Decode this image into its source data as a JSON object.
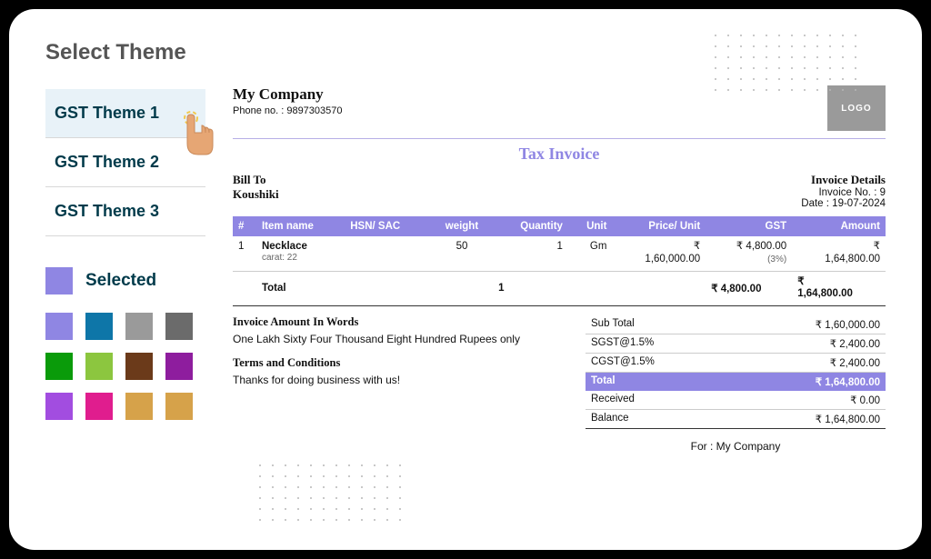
{
  "sidebar": {
    "title": "Select Theme",
    "themes": [
      "GST Theme 1",
      "GST Theme 2",
      "GST Theme 3"
    ],
    "selected_index": 0,
    "selected_label": "Selected",
    "palette_colors": [
      "#8f86e3",
      "#0e76a8",
      "#9a9a9a",
      "#6b6b6b",
      "#0a9b0a",
      "#8cc63f",
      "#6b3a1a",
      "#8e1d9e",
      "#a24de0",
      "#e01d8e",
      "#d6a24a",
      "#d6a24a"
    ]
  },
  "invoice": {
    "company_name": "My Company",
    "phone_label": "Phone no. : ",
    "phone": "9897303570",
    "logo_text": "LOGO",
    "doc_title": "Tax Invoice",
    "bill_to_label": "Bill To",
    "bill_to_name": "Koushiki",
    "details_label": "Invoice Details",
    "invoice_no_label": "Invoice No. : ",
    "invoice_no": "9",
    "date_label": "Date : ",
    "date": "19-07-2024",
    "columns": [
      "#",
      "Item name",
      "HSN/ SAC",
      "weight",
      "Quantity",
      "Unit",
      "Price/ Unit",
      "GST",
      "Amount"
    ],
    "row": {
      "idx": "1",
      "name": "Necklace",
      "subline": "carat: 22",
      "hsn": "",
      "weight": "50",
      "qty": "1",
      "unit": "Gm",
      "price_top": "₹",
      "price": "1,60,000.00",
      "gst_top": "₹ 4,800.00",
      "gst_sub": "(3%)",
      "amount_top": "₹",
      "amount": "1,64,800.00"
    },
    "totals_row": {
      "label": "Total",
      "qty": "1",
      "gst": "₹ 4,800.00",
      "amount_top": "₹",
      "amount": "1,64,800.00"
    },
    "words_label": "Invoice Amount In Words",
    "words": "One Lakh Sixty Four Thousand Eight Hundred Rupees only",
    "terms_label": "Terms and Conditions",
    "terms": "Thanks for doing business with us!",
    "summary": [
      {
        "label": "Sub Total",
        "value": "₹ 1,60,000.00"
      },
      {
        "label": "SGST@1.5%",
        "value": "₹ 2,400.00"
      },
      {
        "label": "CGST@1.5%",
        "value": "₹ 2,400.00"
      }
    ],
    "grand_total": {
      "label": "Total",
      "value": "₹ 1,64,800.00"
    },
    "received": {
      "label": "Received",
      "value": "₹ 0.00"
    },
    "balance": {
      "label": "Balance",
      "value": "₹ 1,64,800.00"
    },
    "for_label": "For : ",
    "for_company": "My Company"
  }
}
